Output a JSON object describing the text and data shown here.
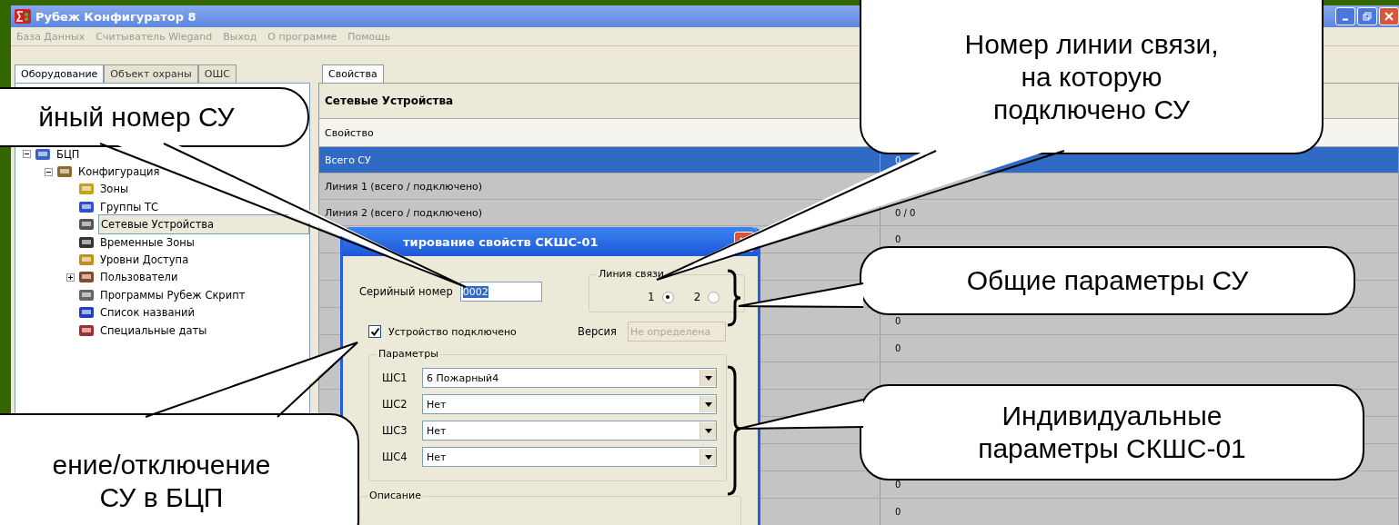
{
  "window": {
    "title": "Рубеж Конфигуратор 8"
  },
  "menu": [
    {
      "label": "База Данных",
      "disabled": true
    },
    {
      "label": "Считыватель Wiegand",
      "disabled": true
    },
    {
      "label": "Выход",
      "disabled": true
    },
    {
      "label": "О программе",
      "disabled": true
    },
    {
      "label": "Помощь",
      "disabled": true
    }
  ],
  "left_tabs": [
    {
      "label": "Оборудование",
      "selected": true
    },
    {
      "label": "Объект охраны",
      "selected": false
    },
    {
      "label": "ОШС",
      "selected": false
    }
  ],
  "tree": [
    {
      "label": "БЦП",
      "expanded": true,
      "selected": false,
      "children": [
        {
          "label": "Конфигурация",
          "expanded": true,
          "selected": false,
          "children": [
            {
              "label": "Зоны",
              "selected": false
            },
            {
              "label": "Группы ТС",
              "selected": false
            },
            {
              "label": "Сетевые Устройства",
              "selected": true
            },
            {
              "label": "Временные Зоны",
              "selected": false
            },
            {
              "label": "Уровни Доступа",
              "selected": false
            },
            {
              "label": "Пользователи",
              "expanded": false,
              "selected": false
            },
            {
              "label": "Программы Рубеж Скрипт",
              "selected": false
            },
            {
              "label": "Список названий",
              "selected": false
            },
            {
              "label": "Специальные даты",
              "selected": false
            }
          ]
        }
      ]
    }
  ],
  "right_tabs": [
    {
      "label": "Свойства",
      "selected": true
    }
  ],
  "properties": {
    "title": "Сетевые Устройства",
    "column_1": "Свойство",
    "rows": [
      {
        "name": "Всего СУ",
        "value": "0",
        "selected": true
      },
      {
        "name": "Линия 1 (всего / подключено)",
        "selected": false
      },
      {
        "name": "Линия 2 (всего / подключено)",
        "value": "0 / 0",
        "selected": false
      },
      {
        "value": "0",
        "selected": false
      },
      {
        "selected": false
      },
      {
        "selected": false
      },
      {
        "value": "0",
        "selected": false
      },
      {
        "value": "0",
        "selected": false
      },
      {
        "selected": false
      },
      {
        "selected": false
      },
      {
        "selected": false
      },
      {
        "selected": false
      },
      {
        "value": "0",
        "selected": false
      },
      {
        "value": "0",
        "selected": false
      }
    ]
  },
  "dialog": {
    "title": "тирование свойств СКШС-01",
    "serial_label": "Серийный номер",
    "serial_value": "0002",
    "line_group": "Линия связи",
    "line_options": [
      {
        "label": "1",
        "selected": true
      },
      {
        "label": "2",
        "selected": false
      }
    ],
    "connected": {
      "label": "Устройство подключено",
      "checked": true
    },
    "version_label": "Версия",
    "version_value": "Не определена",
    "version_disabled": true,
    "params_group": "Параметры",
    "params": [
      {
        "label": "ШС1",
        "value": "6 Пожарный4"
      },
      {
        "label": "ШС2",
        "value": "Нет"
      },
      {
        "label": "ШС3",
        "value": "Нет"
      },
      {
        "label": "ШС4",
        "value": "Нет"
      }
    ],
    "description_group": "Описание"
  },
  "callouts": [
    {
      "text": "йный номер СУ"
    },
    {
      "text": "Номер линии связи,\nна которую\nподключено СУ"
    },
    {
      "text": "Общие параметры СУ"
    },
    {
      "text": "Индивидуальные\nпараметры СКШС-01"
    },
    {
      "text": "ение/отключение\nСУ в БЦП"
    }
  ]
}
